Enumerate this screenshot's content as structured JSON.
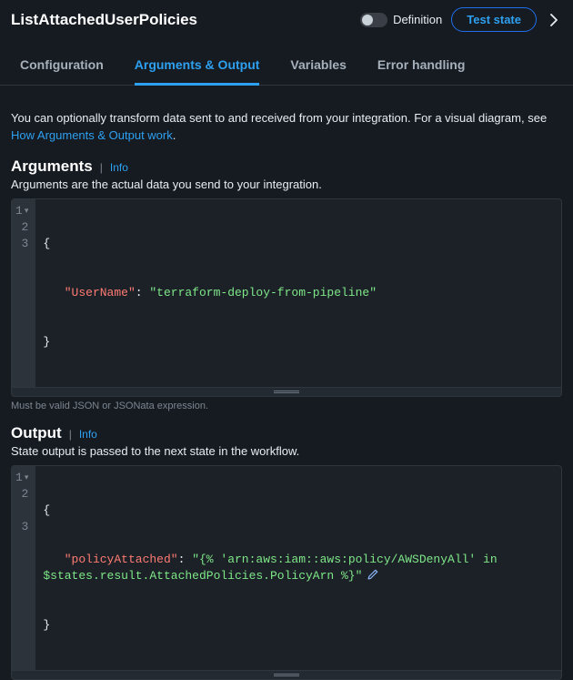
{
  "header": {
    "title": "ListAttachedUserPolicies",
    "toggle_label": "Definition",
    "test_button": "Test state"
  },
  "tabs": [
    {
      "label": "Configuration",
      "active": false
    },
    {
      "label": "Arguments & Output",
      "active": true
    },
    {
      "label": "Variables",
      "active": false
    },
    {
      "label": "Error handling",
      "active": false
    }
  ],
  "intro": {
    "text": "You can optionally transform data sent to and received from your integration. For a visual diagram, see ",
    "link_text": "How Arguments & Output work",
    "period": "."
  },
  "arguments": {
    "heading": "Arguments",
    "info": "Info",
    "desc": "Arguments are the actual data you send to your integration.",
    "code": {
      "l1": "{",
      "l2_key": "\"UserName\"",
      "l2_colon": ": ",
      "l2_val": "\"terraform-deploy-from-pipeline\"",
      "l3": "}"
    },
    "hint": "Must be valid JSON or JSONata expression."
  },
  "output": {
    "heading": "Output",
    "info": "Info",
    "desc": "State output is passed to the next state in the workflow.",
    "code": {
      "l1": "{",
      "l2_key": "\"policyAttached\"",
      "l2_colon": ": ",
      "l2_val_a": "\"{% 'arn:aws:iam::aws:policy/AWSDenyAll' in ",
      "l2_val_b": "$states.result.AttachedPolicies.PolicyArn %}\"",
      "l3": "}"
    }
  },
  "line_numbers": [
    "1",
    "2",
    "3"
  ]
}
